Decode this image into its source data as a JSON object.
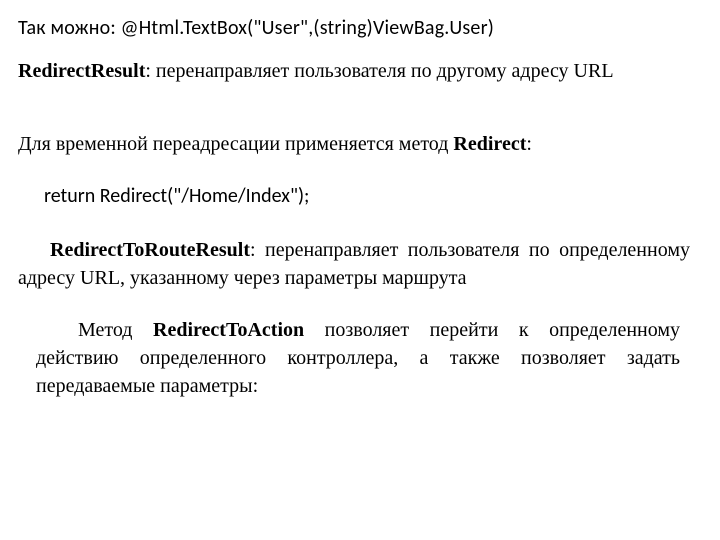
{
  "line1": {
    "prefix": "Так можно:  ",
    "code": "@Html.TextBox(\"User\",(string)ViewBag.User)"
  },
  "redirectResult": {
    "bold": "RedirectResult",
    "text": ": перенаправляет пользователя по другому адресу URL"
  },
  "redirectPara": {
    "prefix": "Для временной переадресации применяется метод ",
    "bold": "Redirect",
    "suffix": ":"
  },
  "codeLine": "return Redirect(\"/Home/Index\");",
  "routeResult": {
    "bold": "RedirectToRouteResult",
    "text": ": перенаправляет пользователя по определенному адресу URL, указанному через параметры маршрута"
  },
  "actionPara": {
    "prefix": "Метод ",
    "bold": "RedirectToAction",
    "suffix": " позволяет перейти к определенному действию определенного контроллера, а также позволяет задать передаваемые параметры:"
  }
}
